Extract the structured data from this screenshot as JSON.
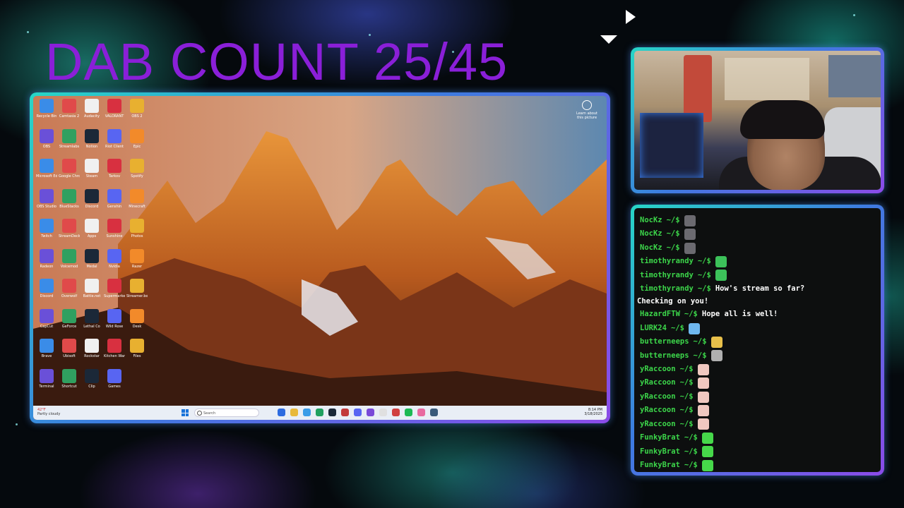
{
  "overlay": {
    "title": "DAB COUNT 25/45"
  },
  "desktop": {
    "icons": [
      [
        "Recycle Bin",
        "Camtasia 2",
        "Audacity",
        "VALORANT",
        "OBS 2"
      ],
      [
        "OBS",
        "Streamlabs",
        "Notion",
        "Riot Client",
        "Epic"
      ],
      [
        "Microsoft Edge",
        "Google Chrome",
        "Steam",
        "Tarkov",
        "Spotify"
      ],
      [
        "OBS Studio",
        "BlueStacks",
        "Discord",
        "Genshin",
        "Minecraft"
      ],
      [
        "Twitch",
        "StreamDeck",
        "Apps",
        "Sunshine",
        "Photos"
      ],
      [
        "Radeon",
        "Voicemod",
        "Medal",
        "Nvidia",
        "Razer"
      ],
      [
        "Discord",
        "Overwolf",
        "Battle.net",
        "Supermarket Together",
        "Streamer.bot"
      ],
      [
        "CapCut",
        "GeForce",
        "Lethal Co",
        "Wild Rose",
        "Desk"
      ],
      [
        "Brave",
        "Ubisoft",
        "Rockstar",
        "Kitchen Wars",
        "Files"
      ],
      [
        "Terminal",
        "Shortcut",
        "Clip",
        "Games",
        ""
      ]
    ],
    "learn_label": "Learn about this picture",
    "taskbar": {
      "weather_line1": "42°F",
      "weather_line2": "Partly cloudy",
      "search_placeholder": "Search",
      "clock_time": "8:14 PM",
      "clock_date": "3/18/2025"
    }
  },
  "chat": {
    "messages": [
      {
        "user": "NocKz",
        "prompt": "~/$",
        "text": "",
        "emote": "#6b6a70"
      },
      {
        "user": "NocKz",
        "prompt": "~/$",
        "text": "",
        "emote": "#6b6a70"
      },
      {
        "user": "NocKz",
        "prompt": "~/$",
        "text": "",
        "emote": "#6b6a70"
      },
      {
        "user": "timothyrandy",
        "prompt": "~/$",
        "text": "",
        "emote": "#3cc25a"
      },
      {
        "user": "timothyrandy",
        "prompt": "~/$",
        "text": "",
        "emote": "#3cc25a"
      },
      {
        "user": "timothyrandy",
        "prompt": "~/$",
        "text": "How's stream so far?",
        "emote": ""
      },
      {
        "user": "",
        "prompt": "",
        "text": "Checking on you!",
        "emote": "",
        "continuation": true
      },
      {
        "user": "HazardFTW",
        "prompt": "~/$",
        "text": "Hope all is well!",
        "emote": ""
      },
      {
        "user": "LURK24",
        "prompt": "~/$",
        "text": "",
        "emote": "#6fb8f0"
      },
      {
        "user": "butterneeps",
        "prompt": "~/$",
        "text": "",
        "emote": "#e8c04a"
      },
      {
        "user": "butterneeps",
        "prompt": "~/$",
        "text": "",
        "emote": "#b0b0b0"
      },
      {
        "user": "yRaccoon",
        "prompt": "~/$",
        "text": "",
        "emote": "#f0c8c0"
      },
      {
        "user": "yRaccoon",
        "prompt": "~/$",
        "text": "",
        "emote": "#f0c8c0"
      },
      {
        "user": "yRaccoon",
        "prompt": "~/$",
        "text": "",
        "emote": "#f0c8c0"
      },
      {
        "user": "yRaccoon",
        "prompt": "~/$",
        "text": "",
        "emote": "#f0c8c0"
      },
      {
        "user": "yRaccoon",
        "prompt": "~/$",
        "text": "",
        "emote": "#f0c8c0"
      },
      {
        "user": "FunkyBrat",
        "prompt": "~/$",
        "text": "",
        "emote": "#46d84a"
      },
      {
        "user": "FunkyBrat",
        "prompt": "~/$",
        "text": "",
        "emote": "#46d84a"
      },
      {
        "user": "FunkyBrat",
        "prompt": "~/$",
        "text": "",
        "emote": "#46d84a"
      }
    ]
  },
  "colors": {
    "title": "#8a1fd8",
    "frame_start": "#27d6c6",
    "frame_end": "#8b4be8",
    "chat_user": "#3cd64a",
    "chat_bg": "#0d0f0f"
  }
}
